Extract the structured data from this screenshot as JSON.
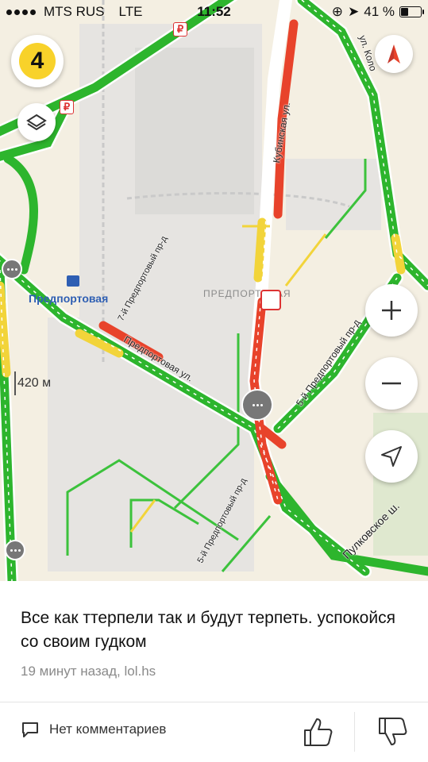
{
  "status_bar": {
    "carrier": "MTS RUS",
    "network": "LTE",
    "time": "11:52",
    "battery_text": "41 %",
    "battery_level": 0.41
  },
  "map": {
    "traffic_score": "4",
    "station_label": "Предпортовая",
    "district_label": "ПРЕДПОРТОВАЯ",
    "scale_label": "420 м",
    "streets": {
      "predportovaya": "Предпортовая ул.",
      "proezd_7": "7-й Предпортовый пр-д",
      "proezd_5_top": "5-й Предпортовый пр-д",
      "proezd_5_bottom": "5-й Предпортовый пр-д",
      "kubinskaya": "Кубинская ул.",
      "pulkovskoe": "Пулковское ш.",
      "okolo": "ул. Коло"
    },
    "colors": {
      "free": "#2db52d",
      "slow": "#f2d43a",
      "jam": "#e8432b",
      "background": "#f4efe2"
    },
    "icons": [
      "traffic-score-icon",
      "layers-icon",
      "compass-icon",
      "zoom-in-icon",
      "zoom-out-icon",
      "location-arrow-icon",
      "ruble-icon",
      "chat-bubble-icon",
      "accident-icon",
      "station-icon"
    ]
  },
  "post": {
    "message": "Все как ттерпели так и будут терпеть. успокойся со своим гудком",
    "meta": "19 минут назад, lol.hs",
    "comments_label": "Нет комментариев"
  }
}
